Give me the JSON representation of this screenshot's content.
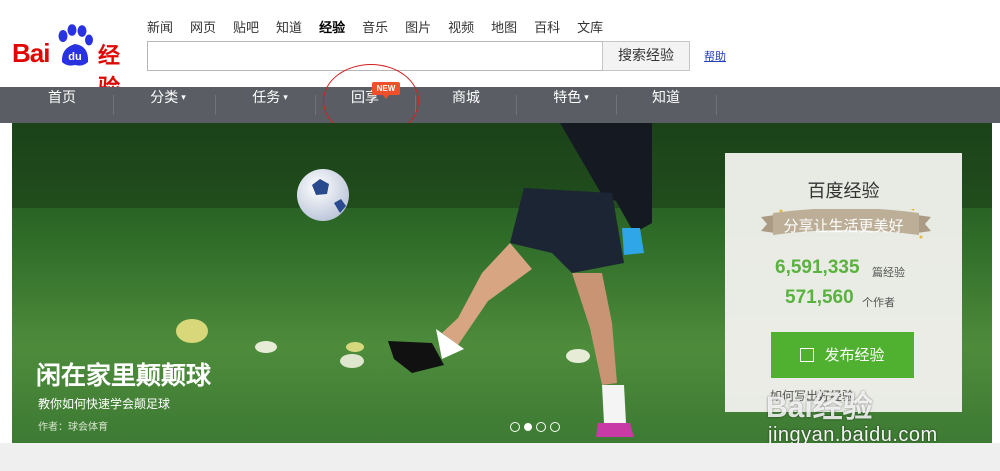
{
  "logo": {
    "bai": "Bai",
    "du": "du",
    "product": "经验"
  },
  "top_nav": [
    "新闻",
    "网页",
    "贴吧",
    "知道",
    "经验",
    "音乐",
    "图片",
    "视频",
    "地图",
    "百科",
    "文库"
  ],
  "top_nav_active": "经验",
  "search": {
    "value": "",
    "placeholder": "",
    "button_label": "搜索经验"
  },
  "help_link": "帮助",
  "main_nav": {
    "home": "首页",
    "category": "分类",
    "task": "任务",
    "share": "回享",
    "mall": "商城",
    "feature": "特色",
    "zhidao": "知道",
    "new_badge": "NEW"
  },
  "banner": {
    "title": "闲在家里颠颠球",
    "subtitle": "教你如何快速学会颠足球",
    "author": "作者：球会体育",
    "slides": 4,
    "active_slide": 1
  },
  "side_card": {
    "title": "百度经验",
    "slogan": "分享让生活更美好",
    "articles_count": "6,591,335",
    "articles_unit": "篇经验",
    "authors_count": "571,560",
    "authors_unit": "个作者",
    "publish_button": "发布经验",
    "footer_text": "如何写出好经验"
  },
  "watermark": {
    "logo": "Bai经验",
    "url": "jingyan.baidu.com"
  },
  "colors": {
    "brand_red": "#e10601",
    "nav_bg": "#5a5d63",
    "accent_green": "#4fb12f",
    "stat_green": "#5ab23f",
    "badge_orange": "#f14f2a"
  }
}
